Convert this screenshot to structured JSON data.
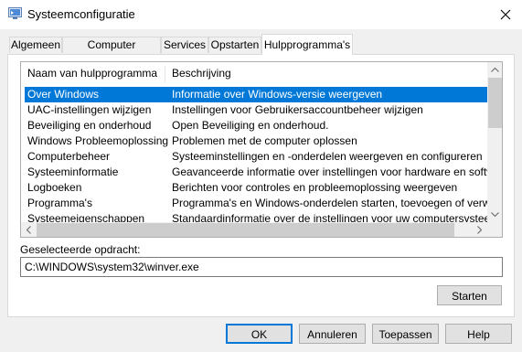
{
  "window": {
    "title": "Systeemconfiguratie",
    "icon": "msconfig-icon",
    "close_glyph": "✕"
  },
  "tabs": [
    {
      "label": "Algemeen",
      "active": false
    },
    {
      "label": "Computer opstarten",
      "active": false
    },
    {
      "label": "Services",
      "active": false
    },
    {
      "label": "Opstarten",
      "active": false
    },
    {
      "label": "Hulpprogramma's",
      "active": true
    }
  ],
  "list": {
    "columns": [
      "Naam van hulpprogramma",
      "Beschrijving"
    ],
    "rows": [
      {
        "name": "Over Windows",
        "description": "Informatie over Windows-versie weergeven",
        "selected": true
      },
      {
        "name": "UAC-instellingen wijzigen",
        "description": "Instellingen voor Gebruikersaccountbeheer wijzigen",
        "selected": false
      },
      {
        "name": "Beveiliging en onderhoud",
        "description": "Open Beveiliging en onderhoud.",
        "selected": false
      },
      {
        "name": "Windows Probleemoplossing",
        "description": "Problemen met de computer oplossen",
        "selected": false
      },
      {
        "name": "Computerbeheer",
        "description": "Systeeminstellingen en -onderdelen weergeven en configureren",
        "selected": false
      },
      {
        "name": "Systeeminformatie",
        "description": "Geavanceerde informatie over instellingen voor hardware en software weergeven",
        "selected": false
      },
      {
        "name": "Logboeken",
        "description": "Berichten voor controles en probleemoplossing weergeven",
        "selected": false
      },
      {
        "name": "Programma's",
        "description": "Programma's en Windows-onderdelen starten, toevoegen of verwijderen",
        "selected": false
      },
      {
        "name": "Systeemeigenschappen",
        "description": "Standaardinformatie over de instellingen voor uw computersysteem weergeven",
        "selected": false
      }
    ]
  },
  "command": {
    "label": "Geselecteerde opdracht:",
    "value": "C:\\WINDOWS\\system32\\winver.exe"
  },
  "buttons": {
    "launch": "Starten",
    "ok": "OK",
    "cancel": "Annuleren",
    "apply": "Toepassen",
    "help": "Help"
  },
  "colors": {
    "selection": "#0078d7",
    "default_button_border": "#0078d7"
  }
}
